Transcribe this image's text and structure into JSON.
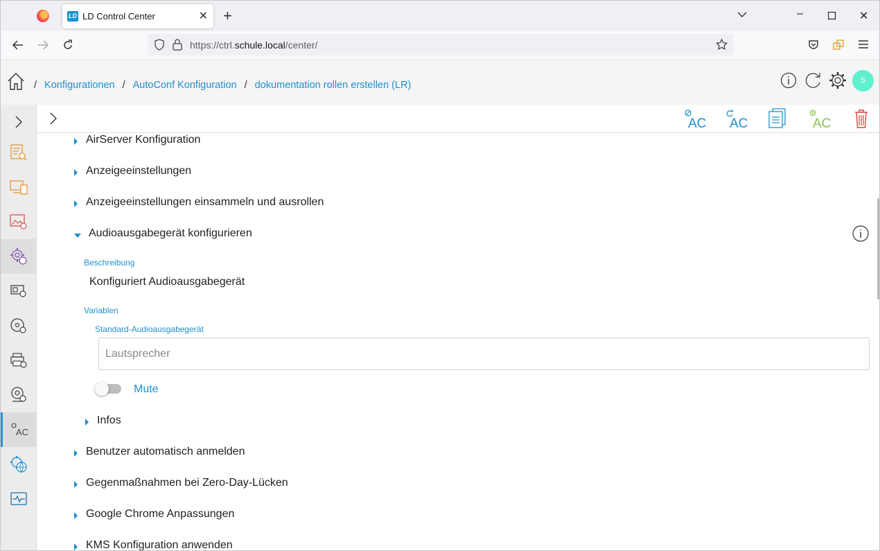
{
  "browser": {
    "tab_title": "LD Control Center",
    "tab_favicon": "LD",
    "url_host_prefix": "https://ctrl.",
    "url_host": "schule.local",
    "url_path": "/center/"
  },
  "header": {
    "breadcrumbs": [
      "Konfigurationen",
      "AutoConf Konfiguration",
      "dokumentation rollen erstellen (LR)"
    ],
    "avatar_initial": "S",
    "accent": "#1e8fd0"
  },
  "toolbar": {
    "icons": [
      "unlink-ac-icon",
      "refresh-ac-icon",
      "document-icon",
      "add-ac-icon",
      "delete-icon"
    ]
  },
  "sections": {
    "s1": "AirServer Konfiguration",
    "s2": "Anzeigeeinstellungen",
    "s3": "Anzeigeeinstellungen einsammeln und ausrollen",
    "s4": "Audioausgabegerät konfigurieren",
    "s5": "Benutzer automatisch anmelden",
    "s6": "Gegenmaßnahmen bei Zero-Day-Lücken",
    "s7": "Google Chrome Anpassungen",
    "s8": "KMS Konfiguration anwenden"
  },
  "expanded": {
    "beschreibung_label": "Beschreibung",
    "beschreibung_value": "Konfiguriert Audioausgabegerät",
    "variablen_label": "Variablen",
    "field_label": "Standard-Audioausgabegerät",
    "field_placeholder": "Lautsprecher",
    "toggle_label": "Mute",
    "toggle_on": false,
    "infos_label": "Infos"
  }
}
